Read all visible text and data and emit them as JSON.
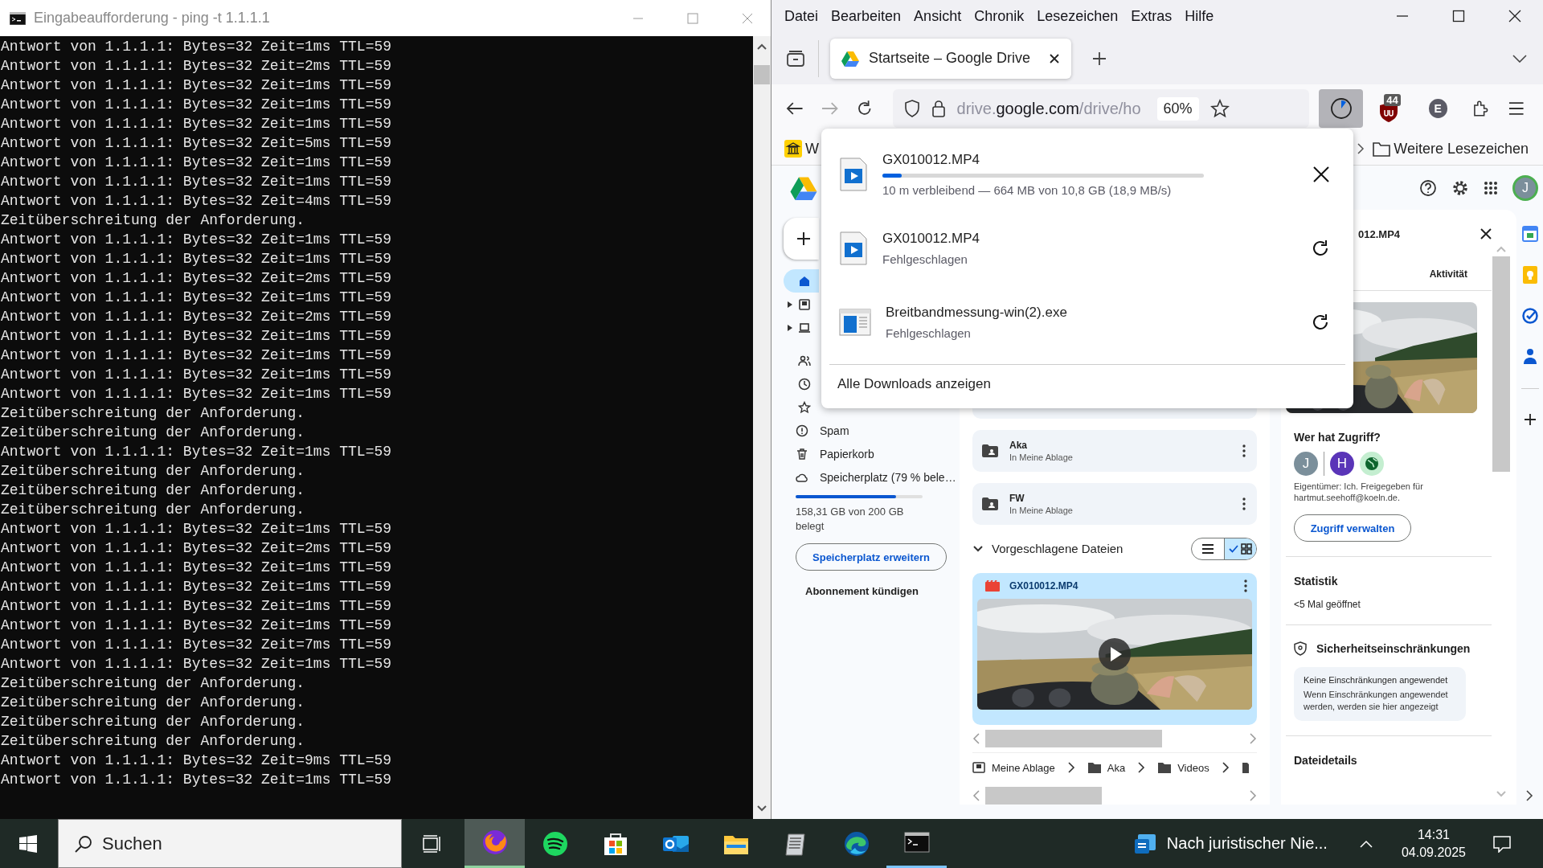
{
  "console": {
    "title": "Eingabeaufforderung - ping  -t 1.1.1.1",
    "lines": [
      "Antwort von 1.1.1.1: Bytes=32 Zeit=1ms TTL=59",
      "Antwort von 1.1.1.1: Bytes=32 Zeit=2ms TTL=59",
      "Antwort von 1.1.1.1: Bytes=32 Zeit=1ms TTL=59",
      "Antwort von 1.1.1.1: Bytes=32 Zeit=1ms TTL=59",
      "Antwort von 1.1.1.1: Bytes=32 Zeit=1ms TTL=59",
      "Antwort von 1.1.1.1: Bytes=32 Zeit=5ms TTL=59",
      "Antwort von 1.1.1.1: Bytes=32 Zeit=1ms TTL=59",
      "Antwort von 1.1.1.1: Bytes=32 Zeit=1ms TTL=59",
      "Antwort von 1.1.1.1: Bytes=32 Zeit=4ms TTL=59",
      "Zeitüberschreitung der Anforderung.",
      "Antwort von 1.1.1.1: Bytes=32 Zeit=1ms TTL=59",
      "Antwort von 1.1.1.1: Bytes=32 Zeit=1ms TTL=59",
      "Antwort von 1.1.1.1: Bytes=32 Zeit=2ms TTL=59",
      "Antwort von 1.1.1.1: Bytes=32 Zeit=1ms TTL=59",
      "Antwort von 1.1.1.1: Bytes=32 Zeit=2ms TTL=59",
      "Antwort von 1.1.1.1: Bytes=32 Zeit=1ms TTL=59",
      "Antwort von 1.1.1.1: Bytes=32 Zeit=1ms TTL=59",
      "Antwort von 1.1.1.1: Bytes=32 Zeit=1ms TTL=59",
      "Antwort von 1.1.1.1: Bytes=32 Zeit=1ms TTL=59",
      "Zeitüberschreitung der Anforderung.",
      "Zeitüberschreitung der Anforderung.",
      "Antwort von 1.1.1.1: Bytes=32 Zeit=1ms TTL=59",
      "Zeitüberschreitung der Anforderung.",
      "Zeitüberschreitung der Anforderung.",
      "Zeitüberschreitung der Anforderung.",
      "Antwort von 1.1.1.1: Bytes=32 Zeit=1ms TTL=59",
      "Antwort von 1.1.1.1: Bytes=32 Zeit=2ms TTL=59",
      "Antwort von 1.1.1.1: Bytes=32 Zeit=1ms TTL=59",
      "Antwort von 1.1.1.1: Bytes=32 Zeit=1ms TTL=59",
      "Antwort von 1.1.1.1: Bytes=32 Zeit=1ms TTL=59",
      "Antwort von 1.1.1.1: Bytes=32 Zeit=1ms TTL=59",
      "Antwort von 1.1.1.1: Bytes=32 Zeit=7ms TTL=59",
      "Antwort von 1.1.1.1: Bytes=32 Zeit=1ms TTL=59",
      "Zeitüberschreitung der Anforderung.",
      "Zeitüberschreitung der Anforderung.",
      "Zeitüberschreitung der Anforderung.",
      "Zeitüberschreitung der Anforderung.",
      "Antwort von 1.1.1.1: Bytes=32 Zeit=9ms TTL=59",
      "Antwort von 1.1.1.1: Bytes=32 Zeit=1ms TTL=59"
    ]
  },
  "firefox": {
    "menu": [
      "Datei",
      "Bearbeiten",
      "Ansicht",
      "Chronik",
      "Lesezeichen",
      "Extras",
      "Hilfe"
    ],
    "tab": {
      "title": "Startseite – Google Drive"
    },
    "url": [
      {
        "text": "drive.",
        "strong": false
      },
      {
        "text": "google.com",
        "strong": true
      },
      {
        "text": "/drive/ho",
        "strong": false
      }
    ],
    "zoom": "60%",
    "extension_badge": "44",
    "profile_initial": "E",
    "bookmarks": [
      {
        "label": "W"
      }
    ],
    "bookmarks_more": "Weitere Lesezeichen",
    "downloads_panel": {
      "open": true,
      "items": [
        {
          "name": "GX010012.MP4",
          "kind": "active",
          "level": 0.06,
          "status": "10 m verbleibend — 664 MB von 10,8 GB (18,9 MB/s)"
        },
        {
          "name": "GX010012.MP4",
          "kind": "failed",
          "status": "Fehlgeschlagen"
        },
        {
          "name": "Breitbandmessung-win(2).exe",
          "kind": "failed",
          "status": "Fehlgeschlagen"
        }
      ],
      "footer": "Alle Downloads anzeigen"
    }
  },
  "drive": {
    "account_initial": "J",
    "nav": [
      {
        "selected": true,
        "expandable": false
      },
      {
        "selected": false,
        "expandable": true
      },
      {
        "selected": false,
        "expandable": true
      },
      {
        "selected": false,
        "expandable": false
      },
      {
        "selected": false,
        "expandable": false
      },
      {
        "selected": false,
        "expandable": false
      }
    ],
    "links": [
      "Spam",
      "Papierkorb",
      "Speicherplatz (79 % bele…"
    ],
    "storage": {
      "level": 0.79,
      "usage": "158,31 GB von 200 GB belegt",
      "upgrade": "Speicherplatz erweitern",
      "cancel": "Abonnement kündigen"
    },
    "folders": [
      {
        "name": "Aka",
        "location": "In Meine Ablage"
      },
      {
        "name": "FW",
        "location": "In Meine Ablage"
      }
    ],
    "suggested": {
      "title": "Vorgeschlagene Dateien",
      "expanded": true,
      "views": [
        {
          "selected": false
        },
        {
          "selected": true
        }
      ],
      "files": [
        {
          "name": "GX010012.MP4"
        }
      ]
    },
    "breadcrumb": [
      "Meine Ablage",
      "Aka",
      "Videos"
    ],
    "details": {
      "title": "012.MP4",
      "tab": "Aktivität",
      "access_title": "Wer hat Zugriff?",
      "people": [
        {
          "initial": "J",
          "color": "#7b8f9b"
        },
        {
          "initial": "H",
          "color": "#5a35b8"
        }
      ],
      "link_shared": true,
      "owner_note": "Eigentümer: Ich. Freigegeben für hartmut.seehoff@koeln.de.",
      "manage": "Zugriff verwalten",
      "stats_title": "Statistik",
      "stats": "<5 Mal geöffnet",
      "security_title": "Sicherheitseinschränkungen",
      "security_status": "Keine Einschränkungen angewendet",
      "security_note": "Wenn Einschränkungen angewendet werden, werden sie hier angezeigt",
      "file_details": "Dateidetails"
    }
  },
  "taskbar": {
    "search_placeholder": "Suchen",
    "apps": [
      {
        "running": true,
        "selected": true
      },
      {
        "running": false,
        "selected": false
      },
      {
        "running": false,
        "selected": false
      },
      {
        "running": false,
        "selected": false
      },
      {
        "running": false,
        "selected": false
      },
      {
        "running": false,
        "selected": false
      },
      {
        "running": false,
        "selected": false
      },
      {
        "running": true,
        "selected": false
      }
    ],
    "notification": "Nach juristischer Nie...",
    "time": "14:31",
    "date": "04.09.2025"
  }
}
